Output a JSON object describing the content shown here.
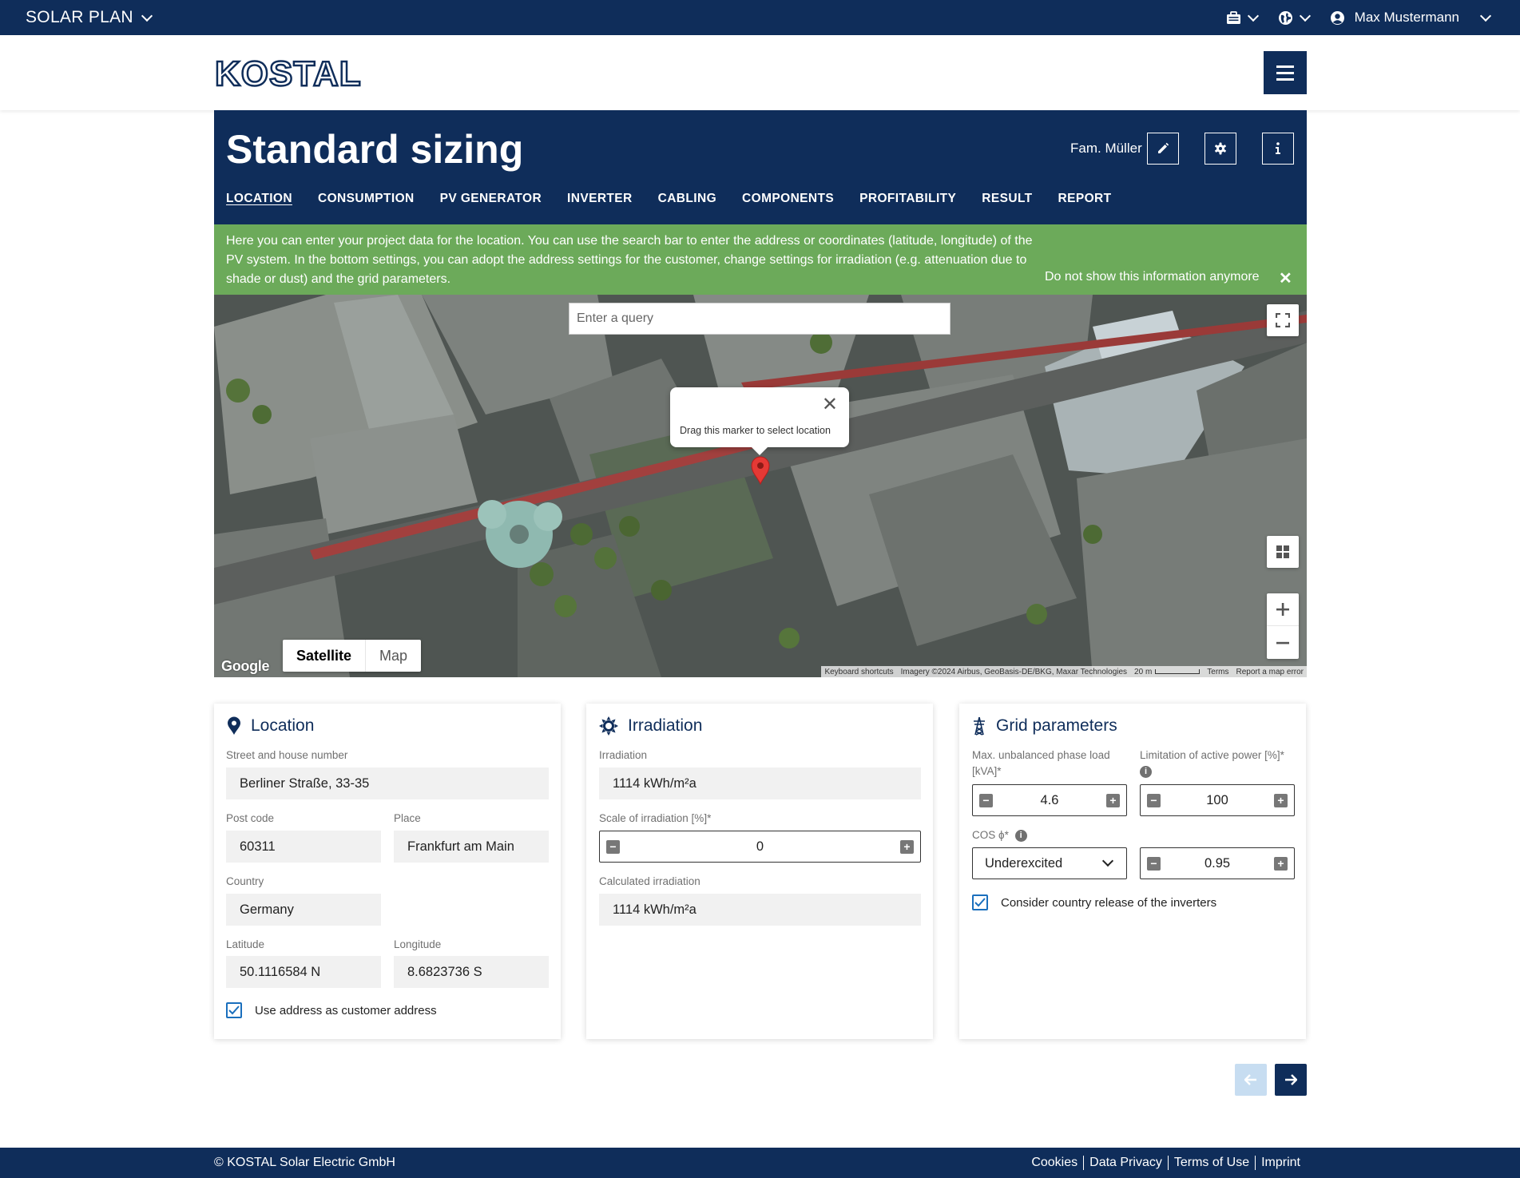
{
  "topbar": {
    "app_name": "SOLAR PLAN",
    "user_name": "Max Mustermann"
  },
  "header": {
    "logo_text": "KOSTAL"
  },
  "pagehead": {
    "title": "Standard sizing",
    "project_name": "Fam. Müller",
    "tabs": [
      {
        "label": "LOCATION",
        "active": true
      },
      {
        "label": "CONSUMPTION"
      },
      {
        "label": "PV GENERATOR"
      },
      {
        "label": "INVERTER"
      },
      {
        "label": "CABLING"
      },
      {
        "label": "COMPONENTS"
      },
      {
        "label": "PROFITABILITY"
      },
      {
        "label": "RESULT"
      },
      {
        "label": "REPORT"
      }
    ]
  },
  "info": {
    "text": "Here you can enter your project data for the location. You can use the search bar to enter the address or coordinates (latitude, longitude) of the PV system. In the bottom settings, you can adopt the address settings for the customer, change settings for irradiation (e.g. attenuation due to shade or dust) and the grid parameters.",
    "dismiss_label": "Do not show this information anymore"
  },
  "map": {
    "search_placeholder": "Enter a query",
    "popup_text": "Drag this marker to select location",
    "maptype_satellite": "Satellite",
    "maptype_map": "Map",
    "google_label": "Google",
    "attribution": {
      "shortcuts": "Keyboard shortcuts",
      "imagery": "Imagery ©2024 Airbus, GeoBasis-DE/BKG, Maxar Technologies",
      "scale": "20 m",
      "terms": "Terms",
      "report": "Report a map error"
    }
  },
  "location_card": {
    "title": "Location",
    "street_label": "Street and house number",
    "street_value": "Berliner Straße, 33-35",
    "postcode_label": "Post code",
    "postcode_value": "60311",
    "place_label": "Place",
    "place_value": "Frankfurt am Main",
    "country_label": "Country",
    "country_value": "Germany",
    "latitude_label": "Latitude",
    "latitude_value": "50.1116584 N",
    "longitude_label": "Longitude",
    "longitude_value": "8.6823736 S",
    "use_address_label": "Use address as customer address",
    "use_address_checked": true
  },
  "irradiation_card": {
    "title": "Irradiation",
    "irradiation_label": "Irradiation",
    "irradiation_value": "1114 kWh/m²a",
    "scale_label": "Scale of irradiation [%]*",
    "scale_value": "0",
    "calculated_label": "Calculated irradiation",
    "calculated_value": "1114 kWh/m²a"
  },
  "grid_card": {
    "title": "Grid parameters",
    "unbalanced_label": "Max. unbalanced phase load [kVA]*",
    "unbalanced_value": "4.6",
    "limitation_label": "Limitation of active power [%]*",
    "limitation_value": "100",
    "cos_label": "COS ϕ*",
    "cos_mode_value": "Underexcited",
    "cos_value": "0.95",
    "country_release_label": "Consider country release of the inverters",
    "country_release_checked": true
  },
  "footer": {
    "copyright": "© KOSTAL Solar Electric GmbH",
    "links": [
      "Cookies",
      "Data Privacy",
      "Terms of Use",
      "Imprint"
    ]
  },
  "colors": {
    "navy": "#0f2d5a",
    "info_green": "#6caa5a",
    "checkbox_blue": "#1a6fbd",
    "marker_red": "#e53935"
  }
}
